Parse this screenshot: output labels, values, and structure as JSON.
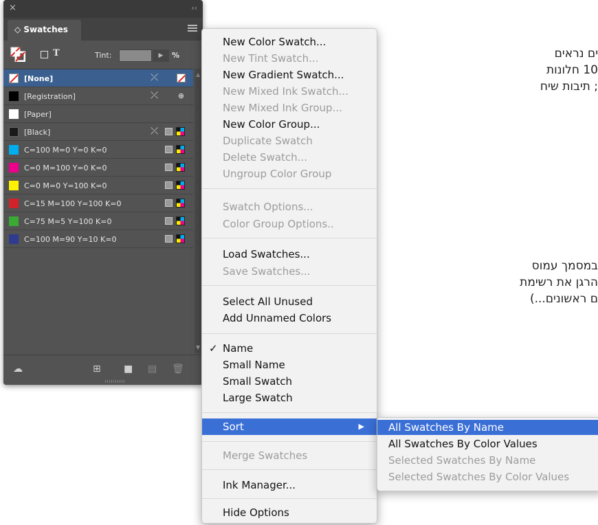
{
  "background_text": [
    "ים נראים",
    "10 חלונות",
    "; תיבות שיח",
    "במסמך עמוס",
    "הרגן את רשימת",
    "ם ראשונים...)"
  ],
  "panel": {
    "close": "×",
    "collapse": "‹‹",
    "tab_label": "◇ Swatches",
    "text_icon": "T",
    "tint_label": "Tint:",
    "tint_arrow": "▶",
    "tint_unit": "%",
    "swatches": [
      {
        "name": "[None]",
        "color": "#ffffff",
        "selected": true
      },
      {
        "name": "[Registration]",
        "color": "#000000",
        "selected": false
      },
      {
        "name": "[Paper]",
        "color": "#ffffff",
        "selected": false
      },
      {
        "name": "[Black]",
        "color": "#1a1a1a",
        "selected": false
      },
      {
        "name": "C=100 M=0 Y=0 K=0",
        "color": "#00aeef",
        "selected": false
      },
      {
        "name": "C=0 M=100 Y=0 K=0",
        "color": "#ec008c",
        "selected": false
      },
      {
        "name": "C=0 M=0 Y=100 K=0",
        "color": "#fff200",
        "selected": false
      },
      {
        "name": "C=15 M=100 Y=100 K=0",
        "color": "#d2232a",
        "selected": false
      },
      {
        "name": "C=75 M=5 Y=100 K=0",
        "color": "#3aaa35",
        "selected": false
      },
      {
        "name": "C=100 M=90 Y=10 K=0",
        "color": "#2e3b8f",
        "selected": false
      }
    ]
  },
  "menu": {
    "items": [
      {
        "label": "New Color Swatch...",
        "disabled": false
      },
      {
        "label": "New Tint Swatch...",
        "disabled": true
      },
      {
        "label": "New Gradient Swatch...",
        "disabled": false
      },
      {
        "label": "New Mixed Ink Swatch...",
        "disabled": true
      },
      {
        "label": "New Mixed Ink Group...",
        "disabled": true
      },
      {
        "label": "New Color Group...",
        "disabled": false
      },
      {
        "label": "Duplicate Swatch",
        "disabled": true
      },
      {
        "label": "Delete Swatch...",
        "disabled": true
      },
      {
        "label": "Ungroup Color Group",
        "disabled": true
      },
      {
        "label": "Swatch Options...",
        "disabled": true
      },
      {
        "label": "Color Group Options..",
        "disabled": true
      },
      {
        "label": "Load Swatches...",
        "disabled": false
      },
      {
        "label": "Save Swatches...",
        "disabled": true
      },
      {
        "label": "Select All Unused",
        "disabled": false
      },
      {
        "label": "Add Unnamed Colors",
        "disabled": false
      },
      {
        "label": "Name",
        "disabled": false,
        "checked": true
      },
      {
        "label": "Small Name",
        "disabled": false
      },
      {
        "label": "Small Swatch",
        "disabled": false
      },
      {
        "label": "Large Swatch",
        "disabled": false
      },
      {
        "label": "Sort",
        "disabled": false,
        "highlighted": true
      },
      {
        "label": "Merge Swatches",
        "disabled": true
      },
      {
        "label": "Ink Manager...",
        "disabled": false
      },
      {
        "label": "Hide Options",
        "disabled": false
      }
    ],
    "check_mark": "✓",
    "submenu_arrow": "▶"
  },
  "submenu": {
    "items": [
      {
        "label": "All Swatches By Name",
        "disabled": false,
        "highlighted": true
      },
      {
        "label": "All Swatches By Color Values",
        "disabled": false
      },
      {
        "label": "Selected Swatches By Name",
        "disabled": true
      },
      {
        "label": "Selected Swatches By Color Values",
        "disabled": true
      }
    ]
  }
}
